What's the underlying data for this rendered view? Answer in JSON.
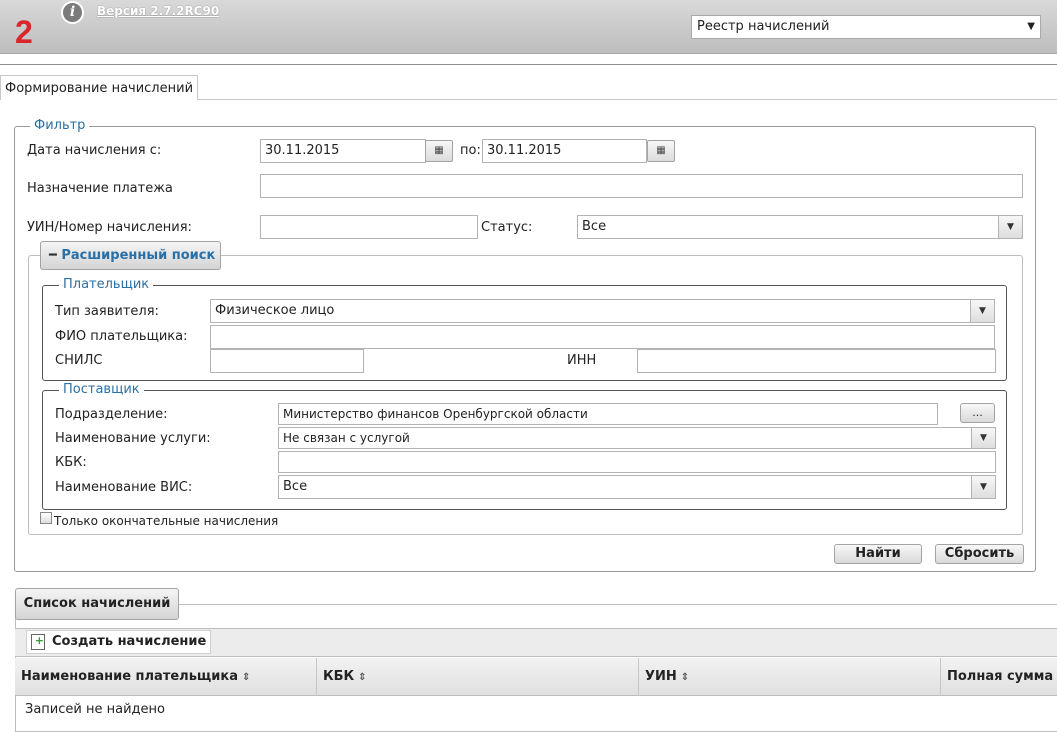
{
  "header": {
    "step_number": "2",
    "info_icon_glyph": "i",
    "version": "Версия 2.7.2RC90",
    "module_select": "Реестр начислений"
  },
  "tab": {
    "label": "Формирование начислений"
  },
  "filter": {
    "legend": "Фильтр",
    "date_label": "Дата начисления с:",
    "date_from": "30.11.2015",
    "date_to_label": "по:",
    "date_to": "30.11.2015",
    "purpose_label": "Назначение платежа",
    "purpose_value": "",
    "uin_label": "УИН/Номер начисления:",
    "uin_value": "",
    "status_label": "Статус:",
    "status_value": "Все"
  },
  "advanced": {
    "toggle_label": "Расширенный поиск",
    "payer": {
      "legend": "Плательщик",
      "type_label": "Тип заявителя:",
      "type_value": "Физическое лицо",
      "fio_label": "ФИО плательщика:",
      "fio_value": "",
      "snils_label": "СНИЛС",
      "snils_value": "",
      "inn_label": "ИНН",
      "inn_value": ""
    },
    "supplier": {
      "legend": "Поставщик",
      "division_label": "Подразделение:",
      "division_value": "Министерство финансов Оренбургской области",
      "division_btn": "...",
      "service_label": "Наименование услуги:",
      "service_value": "Не связан с услугой",
      "kbk_label": "КБК:",
      "kbk_value": "",
      "vis_label": "Наименование ВИС:",
      "vis_value": "Все"
    },
    "final_only_label": "Только окончательные начисления",
    "final_only_checked": false
  },
  "actions": {
    "find": "Найти",
    "reset": "Сбросить"
  },
  "list": {
    "tab_label": "Список начислений",
    "create_label": "Создать начисление",
    "columns": [
      "Наименование плательщика",
      "КБК",
      "УИН",
      "Полная сумма н"
    ],
    "sort_glyph": "⇕",
    "empty_text": "Записей не найдено"
  },
  "colors": {
    "accent": "#2a6fa6",
    "step_red": "#d8262c"
  }
}
